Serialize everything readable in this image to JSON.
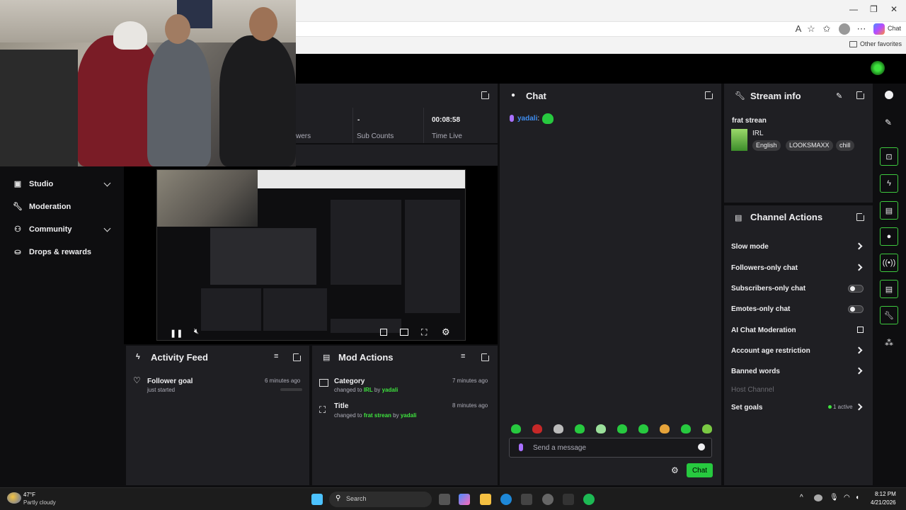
{
  "browser": {
    "read_aloud_label": "A",
    "chat_button_label": "Chat",
    "favorites_label": "Other favorites"
  },
  "nav": {
    "items": [
      {
        "label": "Studio",
        "icon": "studio-icon",
        "expandable": true
      },
      {
        "label": "Moderation",
        "icon": "wrench-icon",
        "expandable": false
      },
      {
        "label": "Community",
        "icon": "community-icon",
        "expandable": true
      },
      {
        "label": "Drops & rewards",
        "icon": "rewards-icon",
        "expandable": false
      }
    ]
  },
  "stats": {
    "viewers_label": "wers",
    "sub_counts_value": "-",
    "sub_counts_label": "Sub Counts",
    "time_live_value": "00:08:58",
    "time_live_label": "Time Live"
  },
  "activity_feed": {
    "title": "Activity Feed",
    "items": [
      {
        "title": "Follower goal",
        "subtitle": "just started",
        "time": "6 minutes ago"
      }
    ]
  },
  "mod_actions": {
    "title": "Mod Actions",
    "items": [
      {
        "title": "Category",
        "prefix": "changed to ",
        "value": "IRL",
        "by": " by ",
        "user": "yadali",
        "time": "7 minutes ago"
      },
      {
        "title": "Title",
        "prefix": "changed to ",
        "value": "frat strean",
        "by": " by ",
        "user": "yadali",
        "time": "8 minutes ago"
      }
    ]
  },
  "chat": {
    "title": "Chat",
    "messages": [
      {
        "user": "yadali",
        "separator": ":"
      }
    ],
    "input_placeholder": "Send a message",
    "send_label": "Chat"
  },
  "stream_info": {
    "title": "Stream info",
    "stream_title": "frat strean",
    "category": "IRL",
    "tags": [
      "English",
      "LOOKSMAXX",
      "chill"
    ]
  },
  "channel_actions": {
    "title": "Channel Actions",
    "rows": [
      {
        "label": "Slow mode",
        "control": "chevron"
      },
      {
        "label": "Followers-only chat",
        "control": "chevron"
      },
      {
        "label": "Subscribers-only chat",
        "control": "toggle"
      },
      {
        "label": "Emotes-only chat",
        "control": "toggle"
      },
      {
        "label": "AI Chat Moderation",
        "control": "external"
      },
      {
        "label": "Account age restriction",
        "control": "chevron"
      },
      {
        "label": "Banned words",
        "control": "chevron"
      },
      {
        "label": "Host Channel",
        "control": "none"
      },
      {
        "label": "Set goals",
        "control": "chevron",
        "badge": "1 active"
      }
    ]
  },
  "taskbar": {
    "weather_temp": "47°F",
    "weather_desc": "Partly cloudy",
    "search_label": "Search",
    "time": "8:12 PM",
    "date": "4/21/2026"
  },
  "colors": {
    "accent": "#3ee33e",
    "panel_bg": "#1f1f23",
    "app_bg": "#0e0e10",
    "mic_purple": "#a970ff",
    "username_blue": "#3f8df0"
  }
}
